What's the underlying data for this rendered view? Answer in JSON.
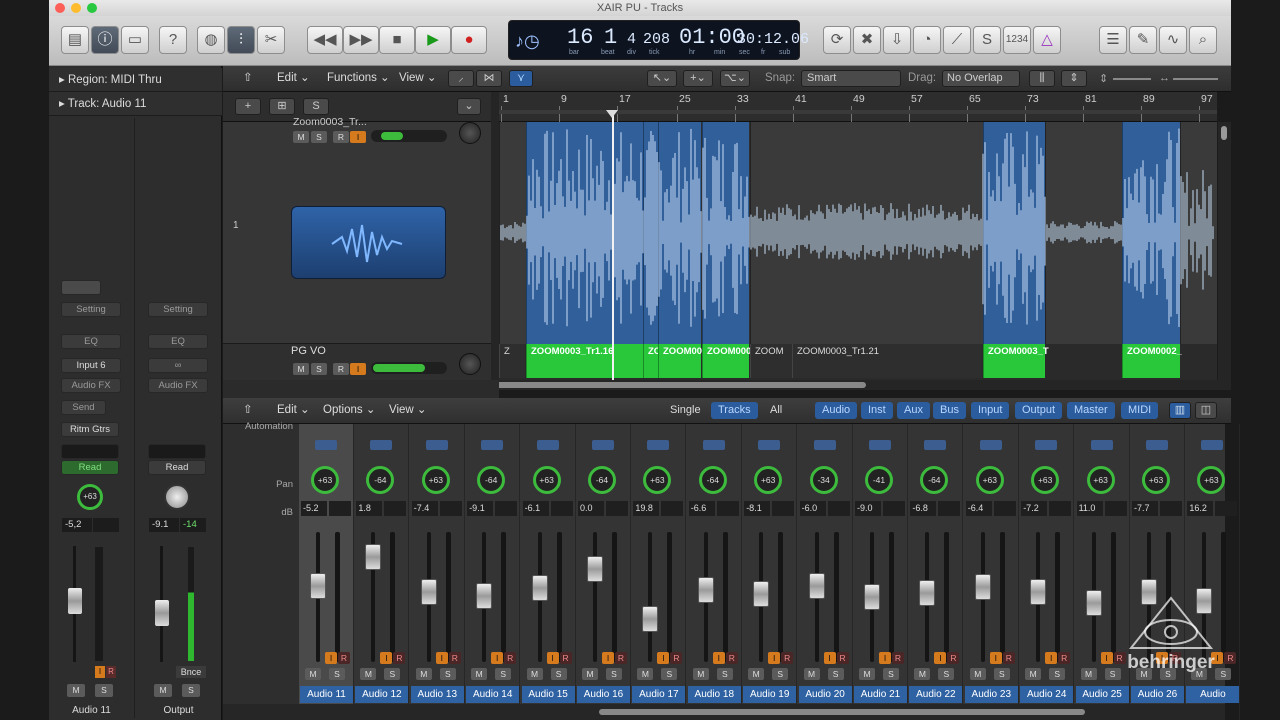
{
  "window": {
    "title": "XAIR PU - Tracks"
  },
  "transport": {
    "bar": "16",
    "beat": "1",
    "div": "4",
    "tick": "208",
    "time_main": "01:00",
    "time_sub": "30:12.06",
    "labels": {
      "bar": "bar",
      "beat": "beat",
      "div": "div",
      "tick": "tick",
      "hr": "hr",
      "min": "min",
      "sec": "sec",
      "fr": "fr",
      "sub": "sub"
    },
    "counter_label": "1234"
  },
  "inspector": {
    "region_row": "Region: MIDI Thru",
    "track_row": "Track: Audio 11",
    "strip_a": {
      "setting": "Setting",
      "eq": "EQ",
      "input": "Input 6",
      "audio_fx": "Audio FX",
      "send": "Send",
      "sendname": "Ritm Gtrs",
      "auto": "Read",
      "pan": "+63",
      "db": "-5,2",
      "name": "Audio 11",
      "m": "M",
      "s": "S",
      "i": "I",
      "r": "R"
    },
    "strip_b": {
      "setting": "Setting",
      "eq": "EQ",
      "audio_fx": "Audio FX",
      "auto": "Read",
      "db": "-9.1",
      "db2": "-14",
      "bounce": "Bnce",
      "name": "Output",
      "m": "M",
      "s": "S"
    }
  },
  "tracks_bar": {
    "edit": "Edit",
    "functions": "Functions",
    "view": "View",
    "snap_label": "Snap:",
    "snap_value": "Smart",
    "drag_label": "Drag:",
    "drag_value": "No Overlap",
    "s_button": "S"
  },
  "ruler": {
    "marks": [
      "1",
      "9",
      "17",
      "25",
      "33",
      "41",
      "49",
      "57",
      "65",
      "73",
      "81",
      "89",
      "97"
    ]
  },
  "tracks": [
    {
      "number": "",
      "name": "Zoom0003_Tr...",
      "m": "M",
      "s": "S",
      "r": "R",
      "i": "I"
    },
    {
      "number": "1",
      "name": "PG VO",
      "m": "M",
      "s": "S",
      "r": "R",
      "i": "I"
    }
  ],
  "regions": [
    {
      "title": "Z"
    },
    {
      "title": "ZOOM0003_Tr1.16"
    },
    {
      "title": "ZC"
    },
    {
      "title": "ZOOM00"
    },
    {
      "title": "ZOOM000"
    },
    {
      "title": "ZOOM"
    },
    {
      "title": "ZOOM0003_Tr1.21"
    },
    {
      "title": "ZOOM0003_T"
    },
    {
      "title": "ZOOM0002_"
    }
  ],
  "mixer_bar": {
    "edit": "Edit",
    "options": "Options",
    "view": "View",
    "filters": [
      "Single",
      "Tracks",
      "All"
    ],
    "types": [
      "Audio",
      "Inst",
      "Aux",
      "Bus",
      "Input",
      "Output",
      "Master",
      "MIDI"
    ],
    "row_labels": {
      "automation": "Automation",
      "pan": "Pan",
      "db": "dB"
    }
  },
  "channels": [
    {
      "name": "Audio 11",
      "pan": "+63",
      "db": "-5.2"
    },
    {
      "name": "Audio 12",
      "pan": "-64",
      "db": "1.8"
    },
    {
      "name": "Audio 13",
      "pan": "+63",
      "db": "-7.4"
    },
    {
      "name": "Audio 14",
      "pan": "-64",
      "db": "-9.1"
    },
    {
      "name": "Audio 15",
      "pan": "+63",
      "db": "-6.1"
    },
    {
      "name": "Audio 16",
      "pan": "-64",
      "db": "0.0"
    },
    {
      "name": "Audio 17",
      "pan": "+63",
      "db": "19.8"
    },
    {
      "name": "Audio 18",
      "pan": "-64",
      "db": "-6.6"
    },
    {
      "name": "Audio 19",
      "pan": "+63",
      "db": "-8.1"
    },
    {
      "name": "Audio 20",
      "pan": "-34",
      "db": "-6.0"
    },
    {
      "name": "Audio 21",
      "pan": "-41",
      "db": "-9.0"
    },
    {
      "name": "Audio 22",
      "pan": "-64",
      "db": "-6.8"
    },
    {
      "name": "Audio 23",
      "pan": "+63",
      "db": "-6.4"
    },
    {
      "name": "Audio 24",
      "pan": "+63",
      "db": "-7.2"
    },
    {
      "name": "Audio 25",
      "pan": "+63",
      "db": "11.0"
    },
    {
      "name": "Audio 26",
      "pan": "+63",
      "db": "-7.7"
    },
    {
      "name": "Audio",
      "pan": "+63",
      "db": "16.2"
    }
  ],
  "channel_buttons": {
    "m": "M",
    "s": "S",
    "i": "I",
    "r": "R"
  },
  "watermark": {
    "brand": "behringer"
  }
}
